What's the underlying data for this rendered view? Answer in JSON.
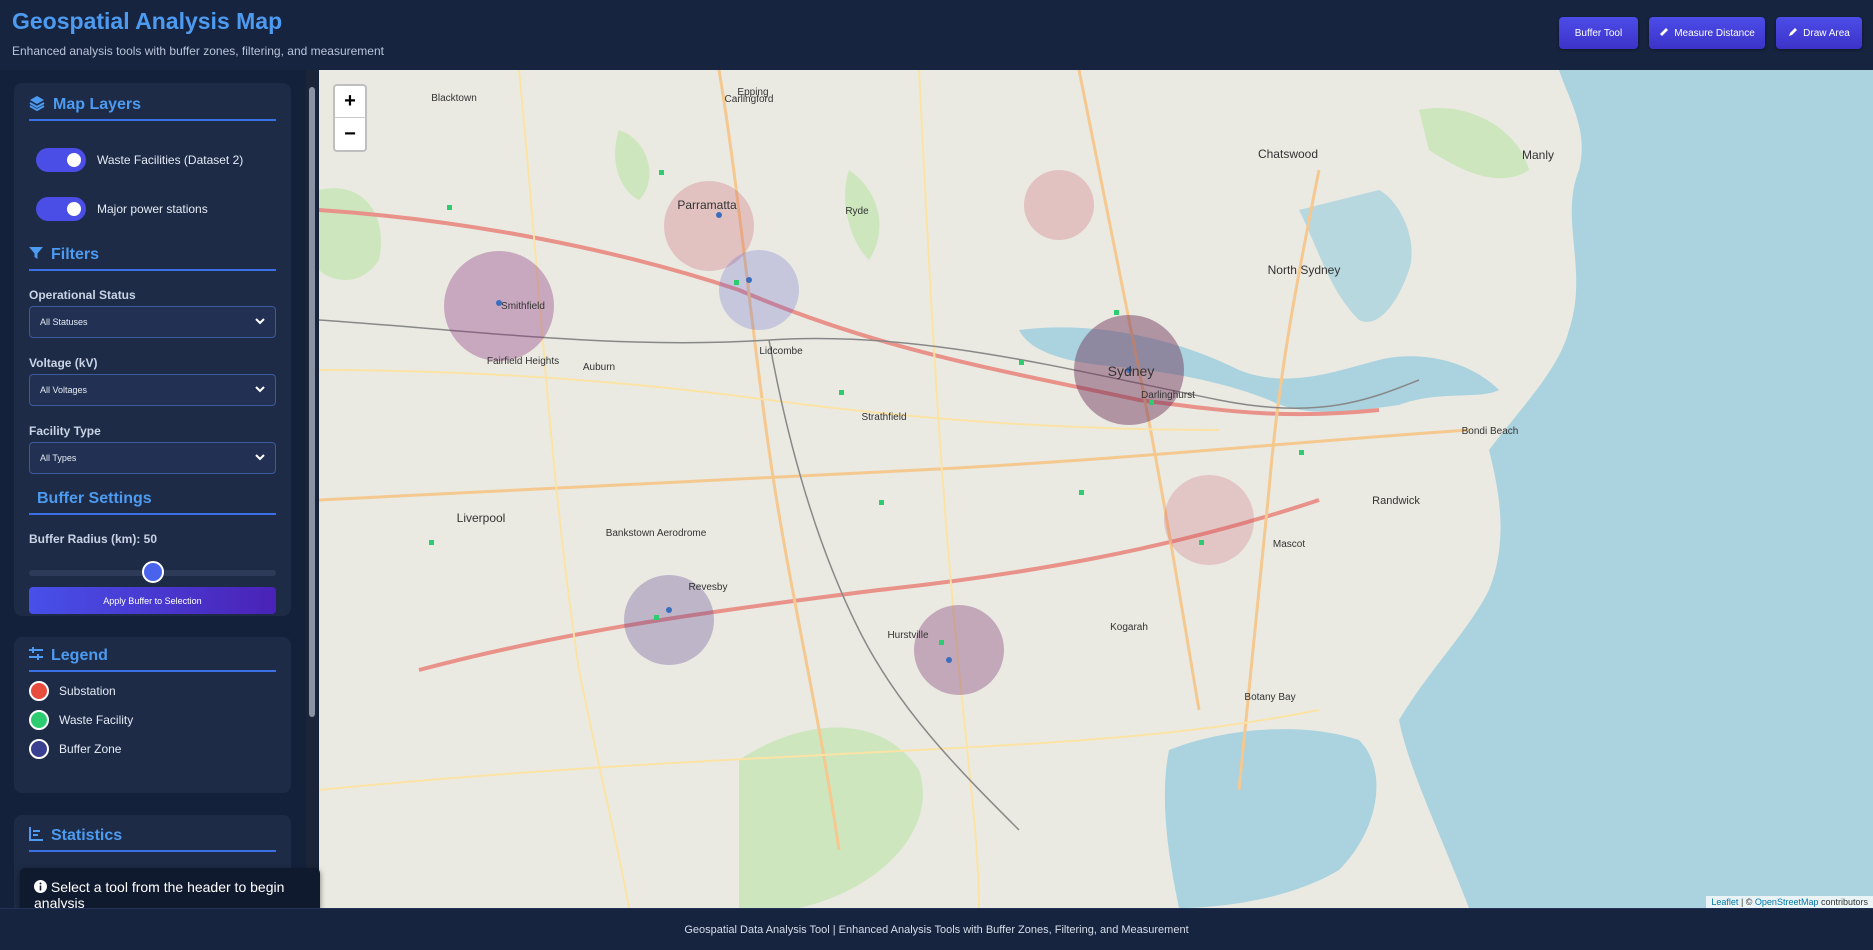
{
  "header": {
    "title": "Geospatial Analysis Map",
    "subtitle": "Enhanced analysis tools with buffer zones, filtering, and measurement",
    "buttons": {
      "buffer_tool": "Buffer Tool",
      "measure_distance": "Measure Distance",
      "draw_area": "Draw Area"
    }
  },
  "sidebar": {
    "layers": {
      "title": "Map Layers",
      "items": [
        {
          "label": "Waste Facilities (Dataset 2)",
          "enabled": true
        },
        {
          "label": "Major power stations",
          "enabled": true
        }
      ]
    },
    "filters": {
      "title": "Filters",
      "operational_status": {
        "label": "Operational Status",
        "value": "All Statuses"
      },
      "voltage": {
        "label": "Voltage (kV)",
        "value": "All Voltages"
      },
      "facility_type": {
        "label": "Facility Type",
        "value": "All Types"
      }
    },
    "buffer": {
      "title": "Buffer Settings",
      "radius_label": "Buffer Radius (km): 50",
      "radius_km": 50,
      "radius_fraction": 0.5,
      "apply_label": "Apply Buffer to Selection"
    },
    "legend": {
      "title": "Legend",
      "items": [
        {
          "label": "Substation",
          "color": "#e74c3c"
        },
        {
          "label": "Waste Facility",
          "color": "#2ecc71"
        },
        {
          "label": "Buffer Zone",
          "color": "#3a3f8f"
        }
      ]
    },
    "statistics": {
      "title": "Statistics"
    }
  },
  "toast": {
    "message": "Select a tool from the header to begin analysis"
  },
  "map": {
    "zoom_in": "+",
    "zoom_out": "−",
    "attribution": {
      "leaflet": "Leaflet",
      "separator": " | © ",
      "osm": "OpenStreetMap",
      "suffix": " contributors"
    },
    "place_labels": [
      {
        "text": "Sydney"
      },
      {
        "text": "Parramatta"
      },
      {
        "text": "North Sydney"
      },
      {
        "text": "Chatswood"
      },
      {
        "text": "Liverpool"
      },
      {
        "text": "Bankstown Aerodrome"
      },
      {
        "text": "Randwick"
      },
      {
        "text": "Manly"
      },
      {
        "text": "Botany Bay"
      },
      {
        "text": "Strathfield"
      },
      {
        "text": "Lidcombe"
      },
      {
        "text": "Revesby"
      },
      {
        "text": "Hurstville"
      },
      {
        "text": "Darlinghurst"
      },
      {
        "text": "Smithfield"
      },
      {
        "text": "Blacktown"
      },
      {
        "text": "Ryde"
      },
      {
        "text": "Epping"
      },
      {
        "text": "Mascot"
      },
      {
        "text": "Bondi Beach"
      },
      {
        "text": "Carlingford"
      },
      {
        "text": "Kogarah"
      },
      {
        "text": "Fairfield Heights"
      },
      {
        "text": "Auburn"
      }
    ]
  },
  "footer": {
    "text": "Geospatial Data Analysis Tool | Enhanced Analysis Tools with Buffer Zones, Filtering, and Measurement"
  }
}
